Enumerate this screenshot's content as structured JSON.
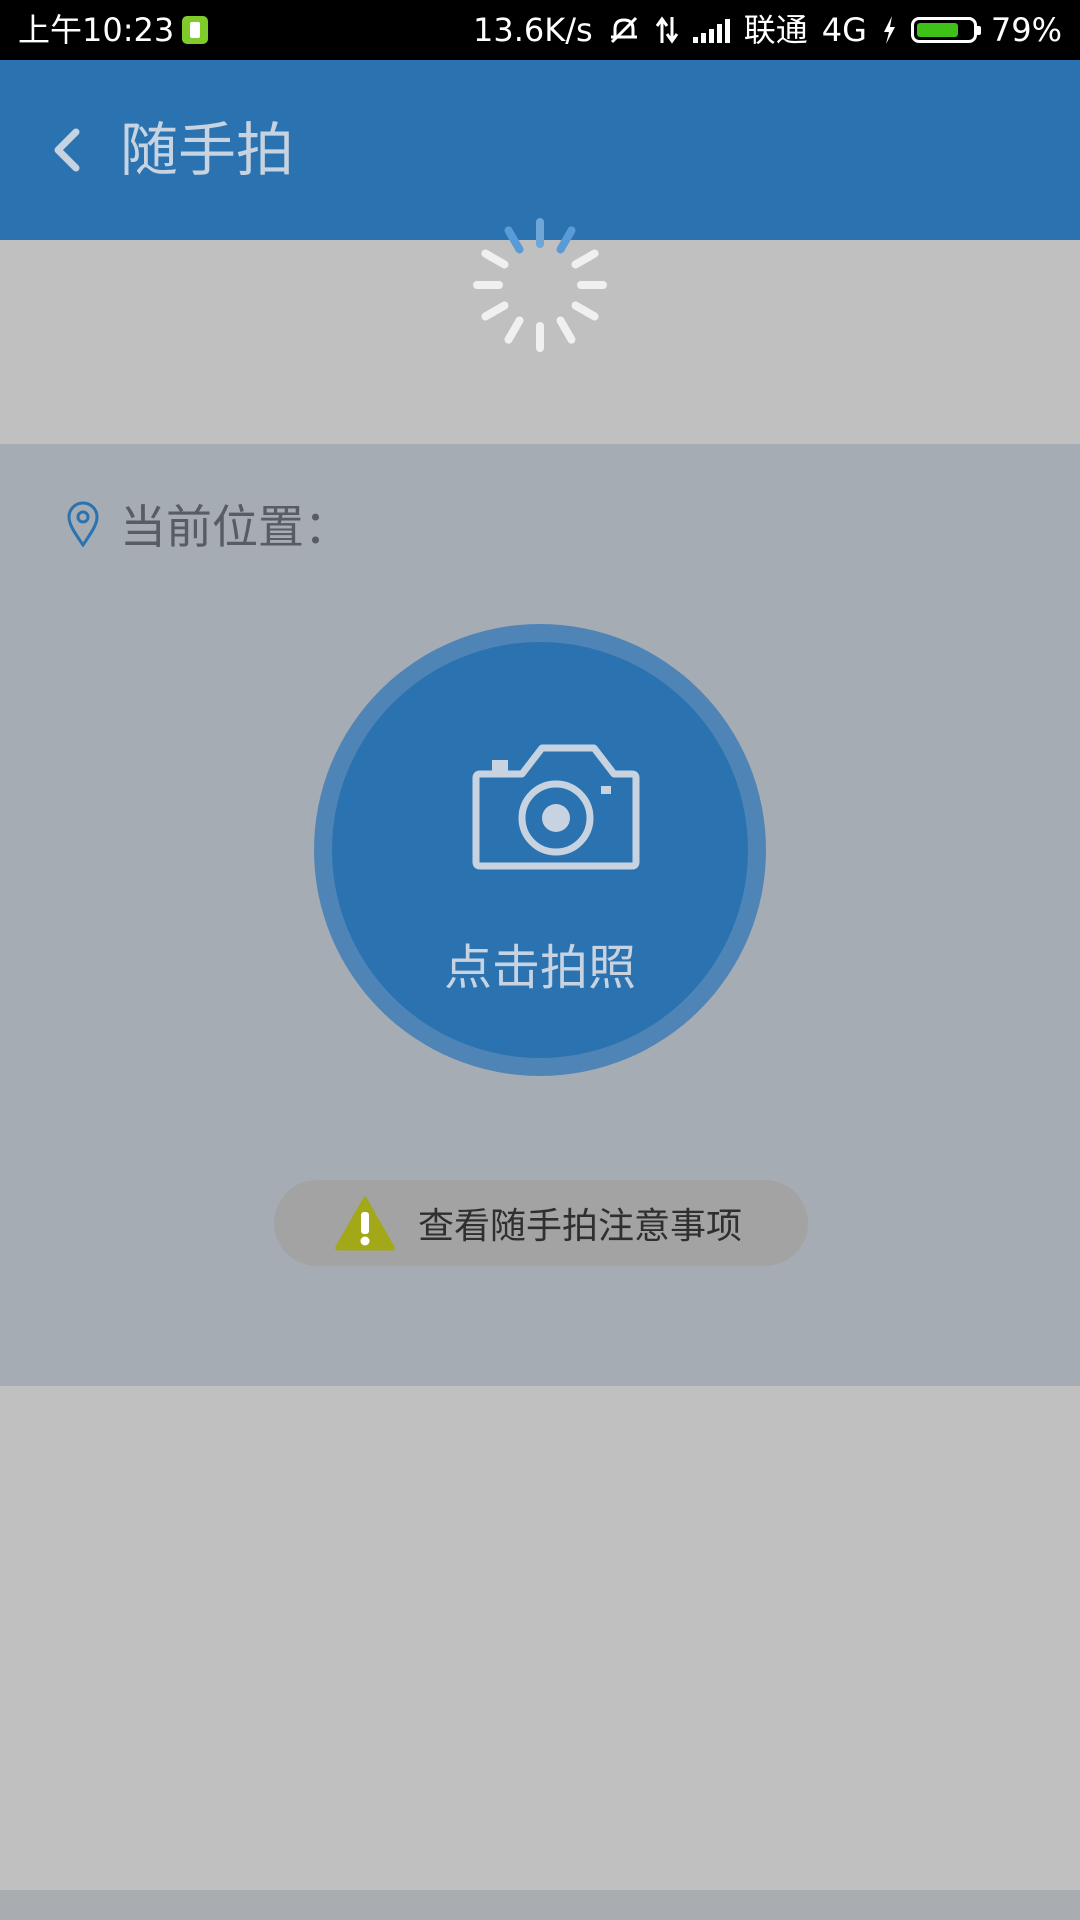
{
  "status_bar": {
    "time": "上午10:23",
    "net_speed": "13.6K/s",
    "carrier": "联通",
    "network": "4G",
    "battery_text": "79%",
    "battery_level": 0.79
  },
  "header": {
    "title": "随手拍"
  },
  "location": {
    "label": "当前位置："
  },
  "capture": {
    "label": "点击拍照"
  },
  "notice": {
    "label": "查看随手拍注意事项"
  },
  "colors": {
    "header_bg": "#2b73b0",
    "panel_bg": "#a5acb3",
    "overlay_bg": "#c0c0c0",
    "capture_ring": "#4f84b6",
    "warning": "#a3a818",
    "battery": "#3ec21a"
  },
  "icons": {
    "back": "chevron-left-icon",
    "spinner": "loading-spinner-icon",
    "pin": "location-pin-icon",
    "camera": "camera-icon",
    "warning": "warning-icon"
  }
}
